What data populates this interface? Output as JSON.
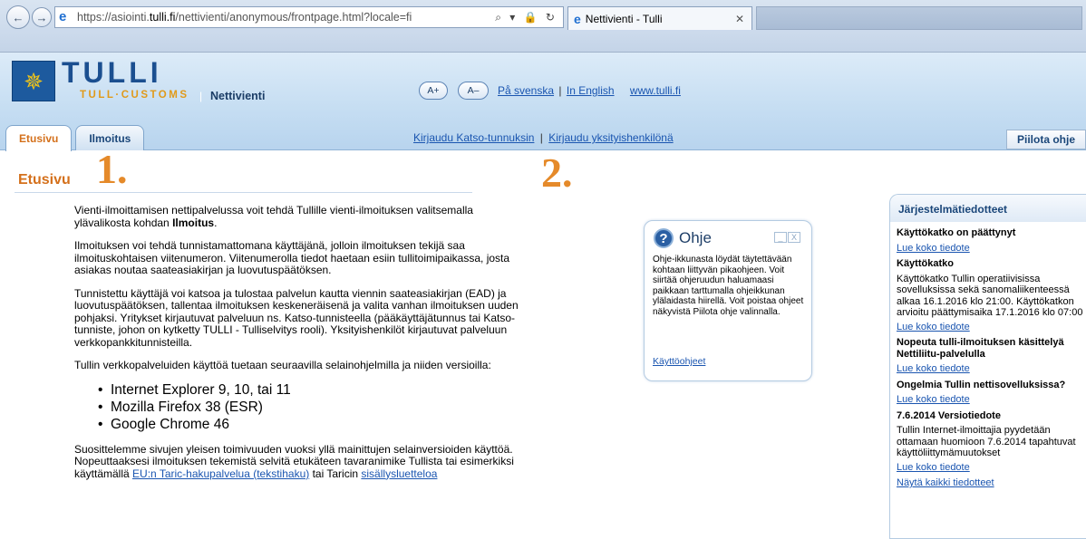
{
  "browser": {
    "url_prefix": "https://asiointi.",
    "url_domain": "tulli.fi",
    "url_path": "/nettivienti/anonymous/frontpage.html?locale=fi",
    "address_icons": "⌕ ▾ 🔒 ↻",
    "tab_title": "Nettivienti - Tulli",
    "tab_close": "✕",
    "back_icon": "←",
    "forward_icon": "→"
  },
  "header": {
    "logo_word": "TULLI",
    "logo_sub": "TULL·CUSTOMS",
    "logo_sep": "|",
    "app_name": "Nettivienti",
    "font_larger": "A+",
    "font_smaller": "A–",
    "lang_sv": "På svenska",
    "lang_sep": "|",
    "lang_en": "In English",
    "site_link": "www.tulli.fi",
    "tabs": [
      {
        "label": "Etusivu",
        "active": true
      },
      {
        "label": "Ilmoitus",
        "active": false
      }
    ],
    "login_katso": "Kirjaudu Katso-tunnuksin",
    "login_sep": "|",
    "login_private": "Kirjaudu yksityishenkilönä",
    "hide_help": "Piilota ohje"
  },
  "main": {
    "title": "Etusivu",
    "annotation_1": "1.",
    "annotation_2": "2.",
    "p1_a": "Vienti-ilmoittamisen nettipalvelussa voit tehdä Tullille vienti-ilmoituksen valitsemalla ylävalikosta kohdan ",
    "p1_b": "Ilmoitus",
    "p1_c": ".",
    "p2": "Ilmoituksen voi tehdä tunnistamattomana käyttäjänä, jolloin ilmoituksen tekijä saa ilmoituskohtaisen viitenumeron. Viitenumerolla tiedot haetaan esiin tullitoimipaikassa, josta asiakas noutaa saateasiakirjan ja luovutuspäätöksen.",
    "p3": "Tunnistettu käyttäjä voi katsoa ja tulostaa palvelun kautta viennin saateasiakirjan (EAD) ja luovutuspäätöksen, tallentaa ilmoituksen keskeneräisenä ja valita vanhan ilmoituksen uuden pohjaksi. Yritykset kirjautuvat palveluun ns. Katso-tunnisteella (pääkäyttäjätunnus tai Katso-tunniste, johon on kytketty TULLI - Tulliselvitys rooli). Yksityishenkilöt kirjautuvat palveluun verkkopankkitunnisteilla.",
    "p4": "Tullin verkkopalveluiden käyttöä tuetaan seuraavilla selainohjelmilla ja niiden versioilla:",
    "browsers": [
      "Internet Explorer  9, 10, tai 11",
      "Mozilla Firefox 38 (ESR)",
      "Google Chrome 46"
    ],
    "p5": "Suosittelemme sivujen yleisen toimivuuden vuoksi yllä mainittujen selainversioiden käyttöä.",
    "p6_a": "Nopeuttaaksesi ilmoituksen tekemistä selvitä etukäteen tavaranimike Tullista tai esimerkiksi käyttämällä ",
    "p6_link": "EU:n Taric-hakupalvelua (tekstihaku)",
    "p6_b": " tai Taricin ",
    "p6_link2": "sisällysluetteloa"
  },
  "help": {
    "title": "Ohje",
    "q_icon": "?",
    "minimize": "_",
    "close": "X",
    "text": "Ohje-ikkunasta löydät täytettävään kohtaan liittyvän pikaohjeen. Voit siirtää ohjeruudun haluamaasi paikkaan tarttumalla ohjeikkunan ylälaidasta hiirellä. Voit poistaa ohjeet näkyvistä Piilota ohje valinnalla.",
    "link": "Käyttöohjeet"
  },
  "notices": {
    "title": "Järjestelmätiedotteet",
    "items": [
      {
        "title": "Käyttökatko on päättynyt",
        "text": "",
        "link": "Lue koko tiedote"
      },
      {
        "title": "Käyttökatko",
        "text": "Käyttökatko Tullin operatiivisissa sovelluksissa sekä sanomaliikenteessä alkaa 16.1.2016 klo 21:00. Käyttökatkon arvioitu päättymisaika 17.1.2016 klo 07:00",
        "link": "Lue koko tiedote"
      },
      {
        "title": "Nopeuta tulli-ilmoituksen käsittelyä Nettiliitu-palvelulla",
        "text": "",
        "link": "Lue koko tiedote"
      },
      {
        "title": "Ongelmia Tullin nettisovelluksissa?",
        "text": "",
        "link": "Lue koko tiedote"
      },
      {
        "title": "7.6.2014 Versiotiedote",
        "text": "Tullin Internet-ilmoittajia pyydetään ottamaan huomioon 7.6.2014 tapahtuvat käyttöliittymämuutokset",
        "link": "Lue koko tiedote"
      }
    ],
    "show_all": "Näytä kaikki tiedotteet"
  }
}
